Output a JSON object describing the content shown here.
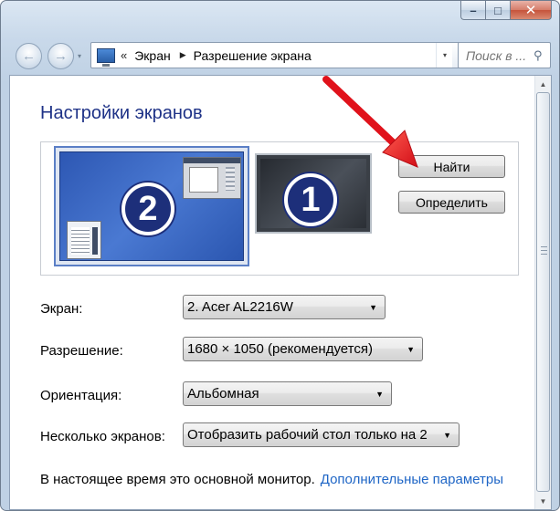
{
  "window": {
    "caption": {
      "minimize_symbol": "–",
      "maximize_symbol": "□",
      "close_symbol": "✕"
    }
  },
  "nav": {
    "back_symbol": "←",
    "forward_symbol": "→",
    "history_dropdown_symbol": "▾",
    "breadcrumb_separator": "«",
    "breadcrumb_triangle": "▶",
    "breadcrumbs": [
      "Экран",
      "Разрешение экрана"
    ],
    "address_dropdown_symbol": "▾",
    "refresh_symbol": "↻",
    "search_placeholder": "Поиск в ...",
    "search_icon": "⚲"
  },
  "content": {
    "title": "Настройки экранов",
    "monitors": [
      {
        "number": "2",
        "selected": true
      },
      {
        "number": "1",
        "selected": false
      }
    ],
    "buttons": {
      "find": "Найти",
      "identify": "Определить"
    },
    "settings": [
      {
        "label": "Экран:",
        "value": "2. Acer AL2216W"
      },
      {
        "label": "Разрешение:",
        "value": "1680 × 1050 (рекомендуется)"
      },
      {
        "label": "Ориентация:",
        "value": "Альбомная"
      },
      {
        "label": "Несколько экранов:",
        "value": "Отобразить рабочий стол только на 2"
      }
    ],
    "combo_arrow": "▼",
    "status_text": "В настоящее время это основной монитор.",
    "advanced_link": "Дополнительные параметры"
  },
  "scrollbar": {
    "up_symbol": "▲",
    "down_symbol": "▼"
  },
  "colors": {
    "title": "#1e3287",
    "link": "#1f66c6",
    "annotation_arrow": "#e0121b",
    "monitor_badge": "#1d2f7a"
  }
}
